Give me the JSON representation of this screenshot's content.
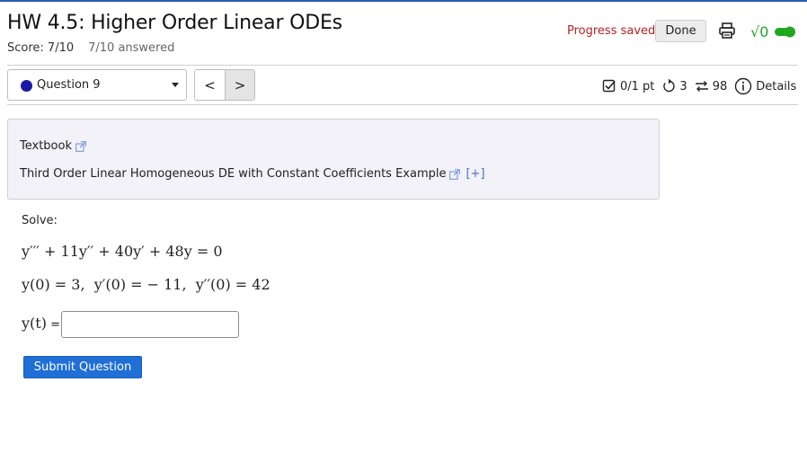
{
  "assignment": {
    "title": "HW 4.5: Higher Order Linear ODEs",
    "score": "Score: 7/10",
    "answered": "7/10 answered"
  },
  "toolbar": {
    "progress_status": "Progress saved",
    "done_label": "Done",
    "print_icon": "printer-icon",
    "math_toggle_icon": "sqrt-toggle-icon",
    "math_toggle_glyph": "√0"
  },
  "question_nav": {
    "selected": "Question 9",
    "prev_glyph": "<",
    "next_glyph": ">"
  },
  "question_meta": {
    "points": "0/1 pt",
    "retries": "3",
    "attempts": "98",
    "details_label": "Details"
  },
  "resources": {
    "textbook_label": "Textbook",
    "example_label": "Third Order Linear Homogeneous DE with Constant Coefficients Example",
    "expand_label": "[+]"
  },
  "problem": {
    "instruction": "Solve:",
    "equation": "y′′′ + 11y′′ + 40y′ + 48y = 0",
    "initial_conditions": "y(0) = 3,  y′(0) = − 11,  y′′(0) = 42",
    "answer_label": "y(t)",
    "answer_eq": " =",
    "answer_value": ""
  },
  "actions": {
    "submit_label": "Submit Question"
  },
  "colors": {
    "accent_blue": "#1f6fd6",
    "saved_red": "#b22222",
    "toggle_green": "#1fa81f"
  }
}
